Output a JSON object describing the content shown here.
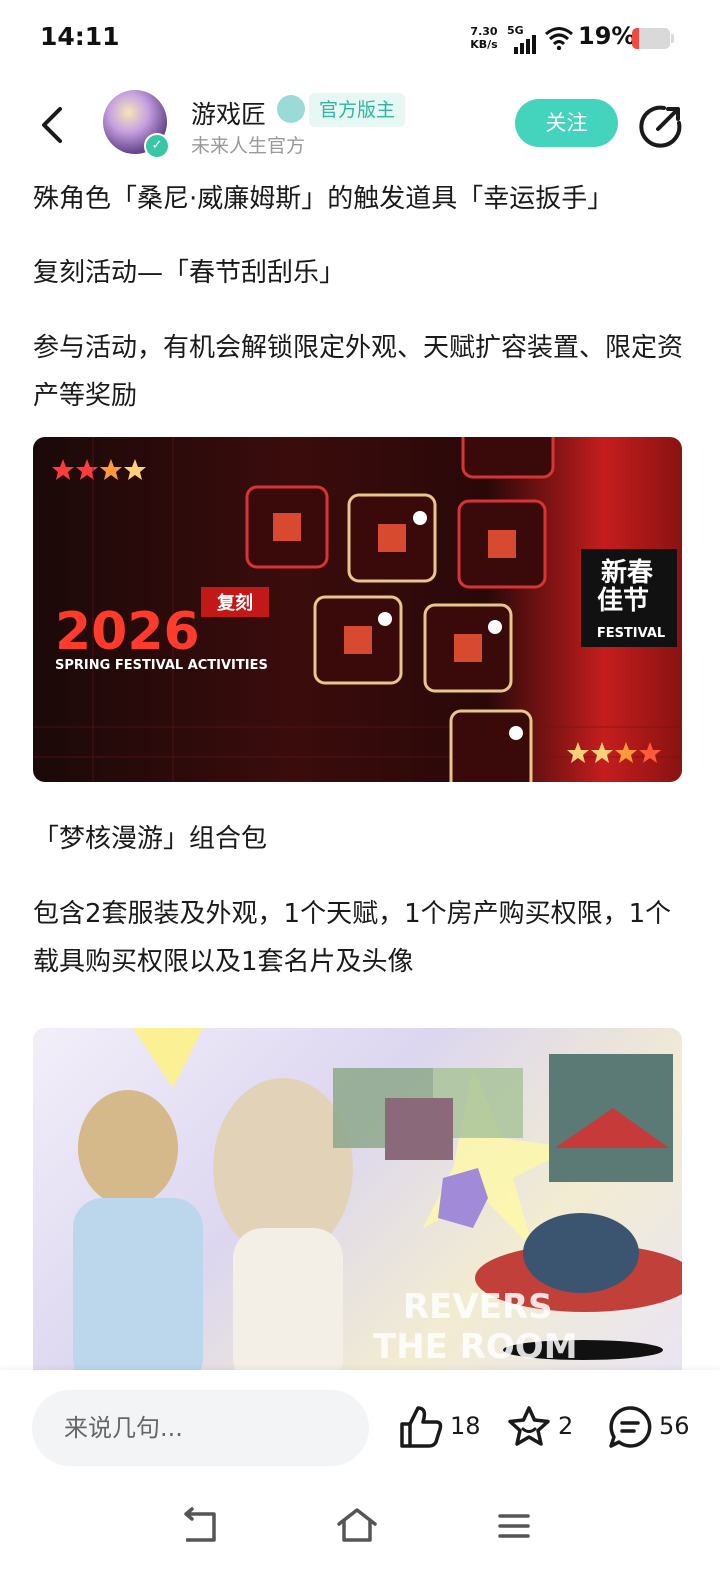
{
  "status": {
    "time": "14:11",
    "net_speed": "7.30",
    "net_unit": "KB/s",
    "signal_label": "5G",
    "battery_pct": "19%",
    "battery_level": 0.19
  },
  "header": {
    "author_name": "游戏匠",
    "badge": "官方版主",
    "subtitle": "未来人生官方",
    "follow_label": "关注"
  },
  "article": {
    "p1": "殊角色「桑尼·威廉姆斯」的触发道具「幸运扳手」",
    "p2": "复刻活动—「春节刮刮乐」",
    "p3": "参与活动，有机会解锁限定外观、天赋扩容装置、限定资产等奖励",
    "p4": "「梦核漫游」组合包",
    "p5": "包含2套服装及外观，1个天赋，1个房产购买权限，1个载具购买权限以及1套名片及头像"
  },
  "image1": {
    "year": "2026",
    "tag": "复刻",
    "caption": "SPRING FESTIVAL ACTIVITIES",
    "panel_title_1": "新春",
    "panel_title_2": "佳节",
    "panel_sub": "FESTIVAL"
  },
  "image2": {
    "watermark_1": "REVERS",
    "watermark_2": "THE ROOM"
  },
  "bottom": {
    "comment_placeholder": "来说几句...",
    "likes": "18",
    "favorites": "2",
    "comments": "56"
  },
  "icons": {
    "back": "back-arrow-icon",
    "share": "share-icon",
    "like": "thumbs-up-icon",
    "favorite": "star-icon",
    "comment": "comment-bubble-icon"
  },
  "colors": {
    "accent": "#44d3bc",
    "badge_text": "#2fb79f",
    "battery_low": "#f24a3c"
  }
}
